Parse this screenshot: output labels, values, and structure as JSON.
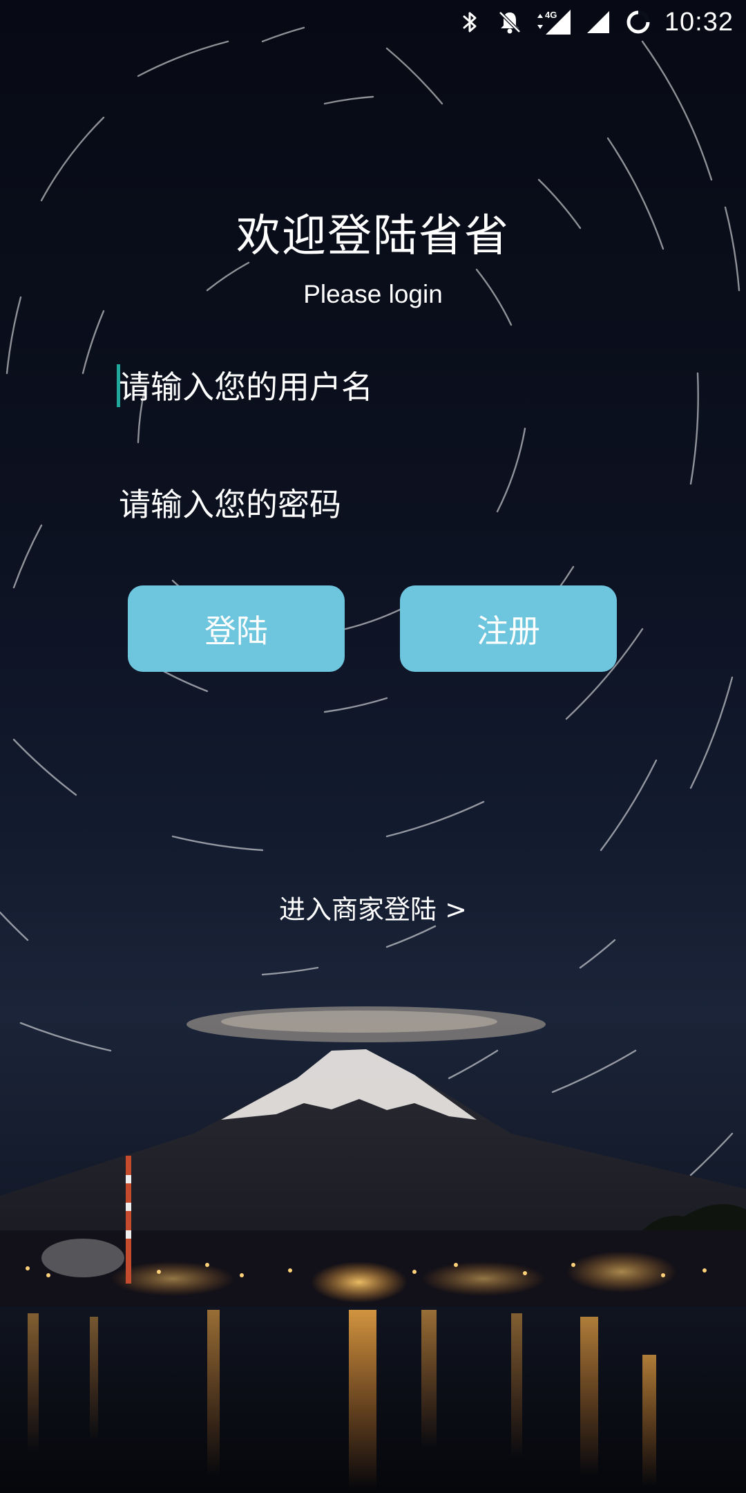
{
  "status_bar": {
    "time": "10:32",
    "network_label": "4G",
    "icons": [
      "bluetooth-icon",
      "notifications-off-icon",
      "data-arrows-icon",
      "signal-4g-icon",
      "signal-icon",
      "loading-ring-icon"
    ]
  },
  "login": {
    "title": "欢迎登陆省省",
    "subtitle": "Please login",
    "username_placeholder": "请输入您的用户名",
    "password_placeholder": "请输入您的密码",
    "login_button": "登陆",
    "register_button": "注册",
    "merchant_link": "进入商家登陆 >"
  },
  "colors": {
    "button_bg": "#6ec6de",
    "caret": "#1fa89b",
    "text": "#ffffff",
    "sky": "#0b0f1a"
  }
}
